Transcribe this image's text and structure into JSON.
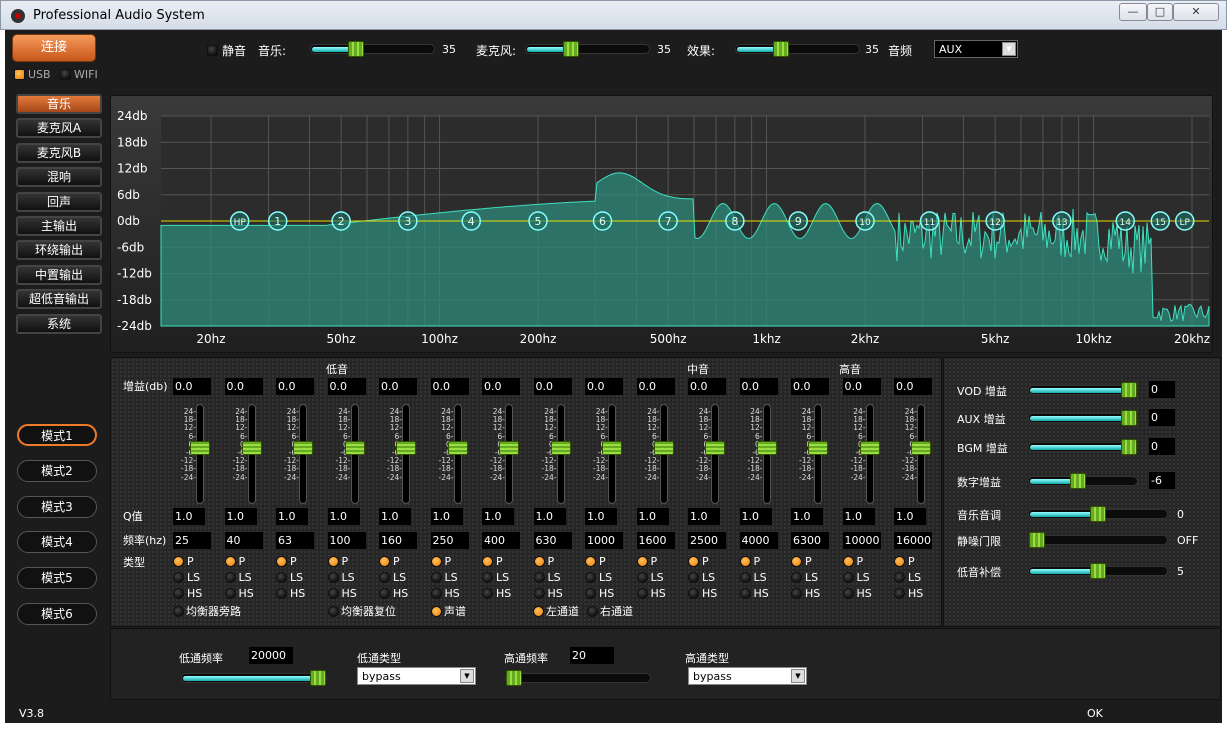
{
  "window": {
    "title": "Professional Audio System",
    "minimize": "—",
    "maximize": "□",
    "close": "✕"
  },
  "connect": {
    "label": "连接",
    "usb": "USB",
    "wifi": "WIFI"
  },
  "top": {
    "mute": "静音",
    "music_label": "音乐:",
    "music_value": "35",
    "music_level": 35,
    "mic_label": "麦克风:",
    "mic_value": "35",
    "mic_level": 35,
    "effect_label": "效果:",
    "effect_value": "35",
    "effect_level": 35,
    "source_label": "音频",
    "source_value": "AUX"
  },
  "sidebar": [
    "音乐",
    "麦克风A",
    "麦克风B",
    "混响",
    "回声",
    "主输出",
    "环绕输出",
    "中置输出",
    "超低音输出",
    "系统"
  ],
  "modes": [
    "模式1",
    "模式2",
    "模式3",
    "模式4",
    "模式5",
    "模式6"
  ],
  "graph": {
    "y_ticks": [
      "24db",
      "18db",
      "12db",
      "6db",
      "0db",
      "-6db",
      "-12db",
      "-18db",
      "-24db"
    ],
    "x_ticks": [
      {
        "label": "20hz",
        "f": 20
      },
      {
        "label": "50hz",
        "f": 50
      },
      {
        "label": "100hz",
        "f": 100
      },
      {
        "label": "200hz",
        "f": 200
      },
      {
        "label": "500hz",
        "f": 500
      },
      {
        "label": "1khz",
        "f": 1000
      },
      {
        "label": "2khz",
        "f": 2000
      },
      {
        "label": "5khz",
        "f": 5000
      },
      {
        "label": "10khz",
        "f": 10000
      },
      {
        "label": "20khz",
        "f": 20000
      }
    ],
    "markers": [
      "HP",
      "1",
      "2",
      "3",
      "4",
      "5",
      "6",
      "7",
      "8",
      "9",
      "10",
      "11",
      "12",
      "13",
      "14",
      "15",
      "LP"
    ]
  },
  "eq": {
    "section_labels": {
      "low": "低音",
      "mid": "中音",
      "high": "高音"
    },
    "gain_label": "增益(db)",
    "q_label": "Q值",
    "freq_label": "频率(hz)",
    "type_label": "类型",
    "scale": [
      "24-",
      "18-",
      "12-",
      "6-",
      "0-",
      "-6-",
      "-12-",
      "-18-",
      "-24-"
    ],
    "type_options": [
      "P",
      "LS",
      "HS"
    ],
    "bands": [
      {
        "gain": "0.0",
        "q": "1.0",
        "freq": "25"
      },
      {
        "gain": "0.0",
        "q": "1.0",
        "freq": "40"
      },
      {
        "gain": "0.0",
        "q": "1.0",
        "freq": "63"
      },
      {
        "gain": "0.0",
        "q": "1.0",
        "freq": "100"
      },
      {
        "gain": "0.0",
        "q": "1.0",
        "freq": "160"
      },
      {
        "gain": "0.0",
        "q": "1.0",
        "freq": "250"
      },
      {
        "gain": "0.0",
        "q": "1.0",
        "freq": "400"
      },
      {
        "gain": "0.0",
        "q": "1.0",
        "freq": "630"
      },
      {
        "gain": "0.0",
        "q": "1.0",
        "freq": "1000"
      },
      {
        "gain": "0.0",
        "q": "1.0",
        "freq": "1600"
      },
      {
        "gain": "0.0",
        "q": "1.0",
        "freq": "2500"
      },
      {
        "gain": "0.0",
        "q": "1.0",
        "freq": "4000"
      },
      {
        "gain": "0.0",
        "q": "1.0",
        "freq": "6300"
      },
      {
        "gain": "0.0",
        "q": "1.0",
        "freq": "10000"
      },
      {
        "gain": "0.0",
        "q": "1.0",
        "freq": "16000"
      }
    ],
    "bypass": "均衡器旁路",
    "reset": "均衡器复位",
    "spectrum": "声谱",
    "left": "左通道",
    "right": "右通道"
  },
  "gains": [
    {
      "label": "VOD 增益",
      "value": "0",
      "level": 100
    },
    {
      "label": "AUX 增益",
      "value": "0",
      "level": 100
    },
    {
      "label": "BGM 增益",
      "value": "0",
      "level": 100
    },
    {
      "label": "数字增益",
      "value": "-6",
      "level": 45
    },
    {
      "label": "音乐音调",
      "value": "0",
      "level": 50
    },
    {
      "label": "静噪门限",
      "value": "OFF",
      "level": 0
    },
    {
      "label": "低音补偿",
      "value": "5",
      "level": 50
    }
  ],
  "filters": {
    "lp_freq_label": "低通频率",
    "lp_freq": "20000",
    "lp_level": 100,
    "lp_type_label": "低通类型",
    "lp_type": "bypass",
    "hp_freq_label": "高通频率",
    "hp_freq": "20",
    "hp_level": 0,
    "hp_type_label": "高通类型",
    "hp_type": "bypass"
  },
  "status": {
    "version": "V3.8",
    "state": "OK"
  }
}
